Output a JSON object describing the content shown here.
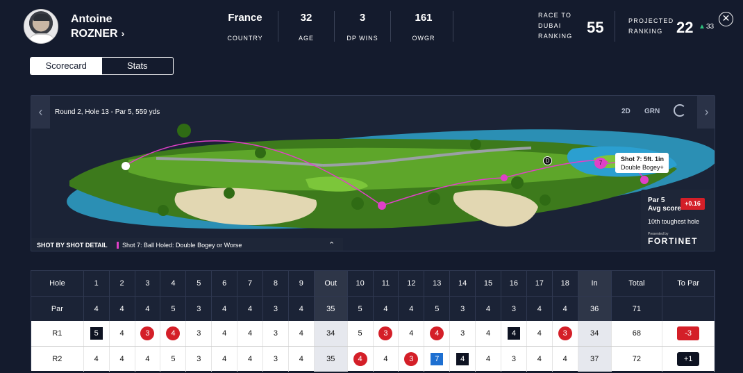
{
  "player": {
    "first_name": "Antoine",
    "last_name": "ROZNER"
  },
  "stats": [
    {
      "value": "France",
      "label": "COUNTRY"
    },
    {
      "value": "32",
      "label": "AGE"
    },
    {
      "value": "3",
      "label": "DP WINS"
    },
    {
      "value": "161",
      "label": "OWGR"
    }
  ],
  "race": {
    "label_1": "RACE TO",
    "label_2": "DUBAI",
    "label_3": "RANKING",
    "value": "55"
  },
  "projected": {
    "label_1": "PROJECTED",
    "label_2": "RANKING",
    "value": "22",
    "movement": "33"
  },
  "tabs": [
    "Scorecard",
    "Stats"
  ],
  "hole": {
    "title": "Round 2, Hole 13 - Par 5, 559 yds",
    "view_2d": "2D",
    "view_grn": "GRN",
    "callout_line1": "Shot 7: 5ft. 1in",
    "callout_line2": "Double Bogey+",
    "marker_7": "7",
    "marker_d": "D",
    "par_label": "Par 5",
    "avg_label": "Avg score",
    "avg_value": "+0.16",
    "toughest": "10th toughest hole",
    "sponsor_small": "Presented by",
    "sponsor": "FORTINET",
    "shot_detail_label": "SHOT BY SHOT DETAIL",
    "shot_detail_text": "Shot 7: Ball Holed: Double Bogey or Worse"
  },
  "scorecard": {
    "holes": [
      "Hole",
      "1",
      "2",
      "3",
      "4",
      "5",
      "6",
      "7",
      "8",
      "9",
      "Out",
      "10",
      "11",
      "12",
      "13",
      "14",
      "15",
      "16",
      "17",
      "18",
      "In",
      "Total",
      "To Par"
    ],
    "par": [
      "Par",
      "4",
      "4",
      "4",
      "5",
      "3",
      "4",
      "4",
      "3",
      "4",
      "35",
      "5",
      "4",
      "4",
      "5",
      "3",
      "4",
      "3",
      "4",
      "4",
      "36",
      "71",
      ""
    ],
    "r1": [
      "R1",
      "5",
      "4",
      "3",
      "4",
      "3",
      "4",
      "4",
      "3",
      "4",
      "34",
      "5",
      "3",
      "4",
      "4",
      "3",
      "4",
      "4",
      "4",
      "3",
      "34",
      "68",
      "-3"
    ],
    "r2": [
      "R2",
      "4",
      "4",
      "4",
      "5",
      "3",
      "4",
      "4",
      "3",
      "4",
      "35",
      "4",
      "4",
      "3",
      "7",
      "4",
      "4",
      "3",
      "4",
      "4",
      "37",
      "72",
      "+1"
    ]
  },
  "colors": {
    "background": "#141b2d",
    "birdie": "#d41f28",
    "bogey": "#0e1322",
    "double_bogey": "#1d6fd1",
    "shot_path": "#e040c8"
  }
}
